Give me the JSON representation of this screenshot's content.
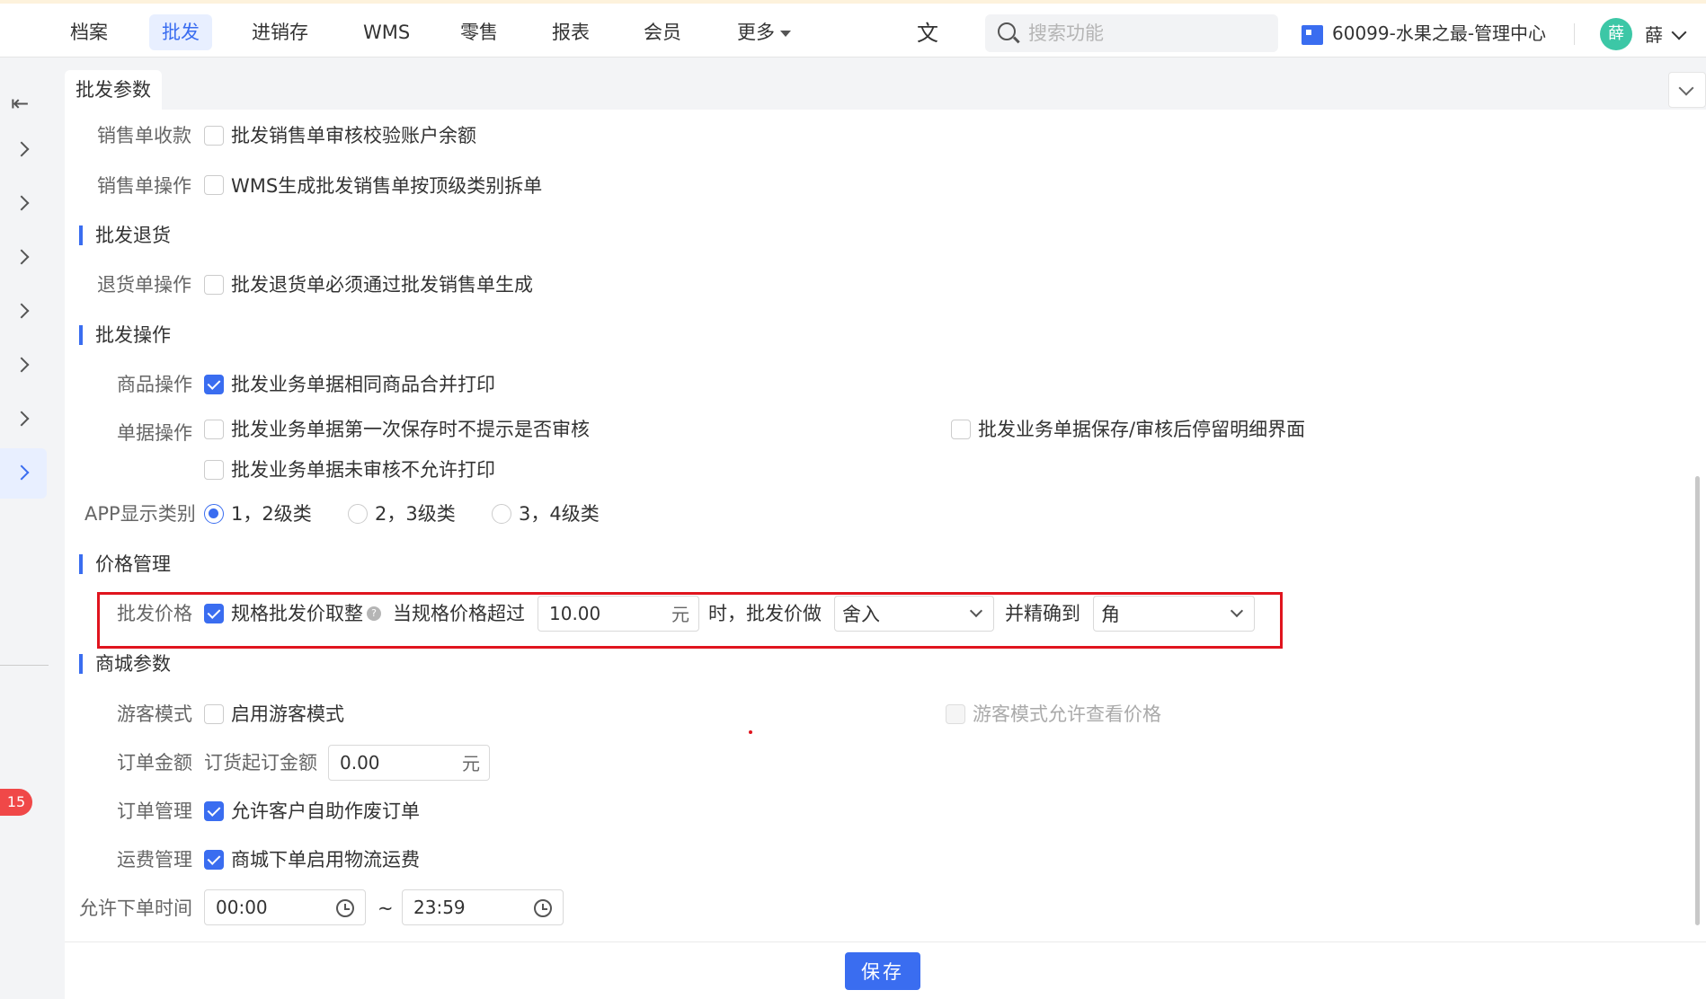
{
  "nav": {
    "items": [
      "档案",
      "批发",
      "进销存",
      "WMS",
      "零售",
      "报表",
      "会员",
      "更多"
    ],
    "active": "批发"
  },
  "search": {
    "placeholder": "搜索功能"
  },
  "store": {
    "name": "60099-水果之最-管理中心"
  },
  "user": {
    "avatar_text": "薛",
    "name": "薛"
  },
  "sidebar": {
    "badge": "15"
  },
  "tab": {
    "title": "批发参数"
  },
  "rows": {
    "sales_receipt": {
      "label": "销售单收款",
      "option": "批发销售单审核校验账户余额",
      "checked": false
    },
    "sales_op": {
      "label": "销售单操作",
      "option": "WMS生成批发销售单按顶级类别拆单",
      "checked": false
    },
    "return_section": "批发退货",
    "return_op": {
      "label": "退货单操作",
      "option": "批发退货单必须通过批发销售单生成",
      "checked": false
    },
    "op_section": "批发操作",
    "goods_op": {
      "label": "商品操作",
      "option": "批发业务单据相同商品合并打印",
      "checked": true
    },
    "doc_op": {
      "label": "单据操作",
      "option1": "批发业务单据第一次保存时不提示是否审核",
      "option2": "批发业务单据保存/审核后停留明细界面",
      "option3": "批发业务单据未审核不允许打印"
    },
    "app_display": {
      "label": "APP显示类别",
      "options": [
        "1，2级类",
        "2，3级类",
        "3，4级类"
      ],
      "selected": "1，2级类"
    },
    "price_section": "价格管理",
    "wholesale_price": {
      "label": "批发价格",
      "option": "规格批发价取整",
      "help": "?",
      "text1": "当规格价格超过",
      "value": "10.00",
      "unit": "元",
      "text2": "时，批发价做",
      "rounding": "舍入",
      "text3": "并精确到",
      "precision": "角"
    },
    "mall_section": "商城参数",
    "guest_mode": {
      "label": "游客模式",
      "option": "启用游客模式",
      "option2": "游客模式允许查看价格"
    },
    "order_amount": {
      "label": "订单金额",
      "text": "订货起订金额",
      "value": "0.00",
      "unit": "元"
    },
    "order_mgmt": {
      "label": "订单管理",
      "option": "允许客户自助作废订单"
    },
    "freight_mgmt": {
      "label": "运费管理",
      "option": "商城下单启用物流运费"
    },
    "order_time": {
      "label": "允许下单时间",
      "start": "00:00",
      "sep": "~",
      "end": "23:59"
    }
  },
  "footer": {
    "save": "保存"
  },
  "colors": {
    "accent": "#3a6df0",
    "highlight": "#e0141e",
    "badge": "#f04848"
  }
}
